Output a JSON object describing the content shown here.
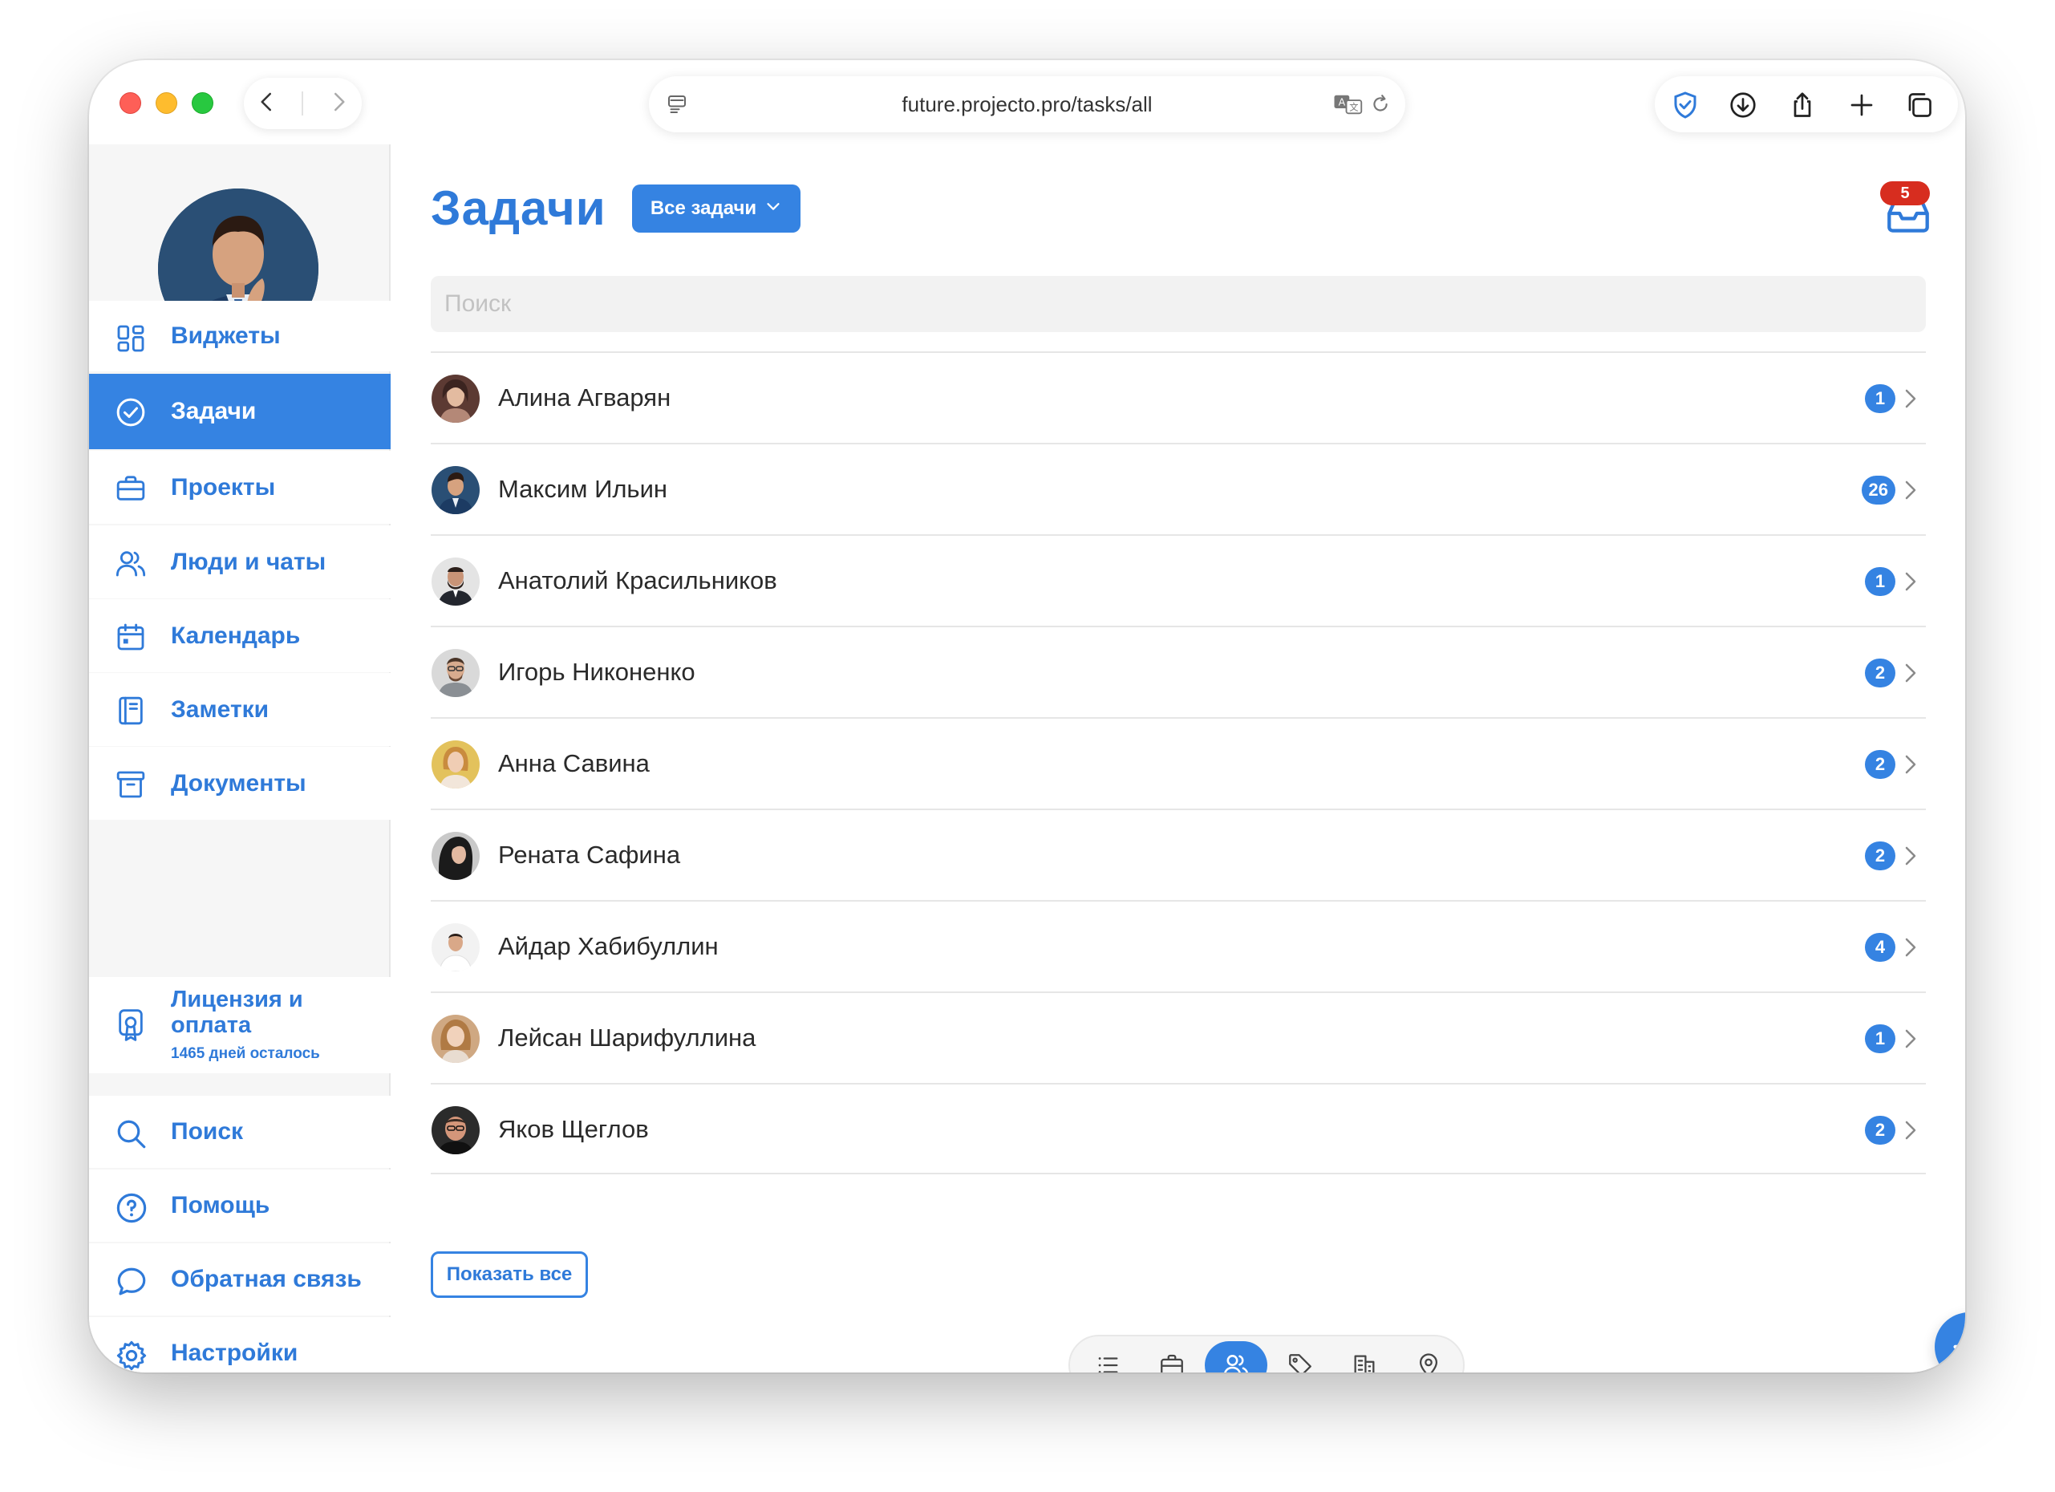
{
  "browser": {
    "url": "future.projecto.pro/tasks/all"
  },
  "sidebar": {
    "items": [
      {
        "label": "Виджеты",
        "icon": "widgets-icon"
      },
      {
        "label": "Задачи",
        "icon": "check-circle-icon",
        "active": true
      },
      {
        "label": "Проекты",
        "icon": "briefcase-icon"
      },
      {
        "label": "Люди и чаты",
        "icon": "people-icon"
      },
      {
        "label": "Календарь",
        "icon": "calendar-icon"
      },
      {
        "label": "Заметки",
        "icon": "notebook-icon"
      },
      {
        "label": "Документы",
        "icon": "archive-icon"
      }
    ],
    "license": {
      "title": "Лицензия и оплата",
      "subtitle": "1465 дней осталось"
    },
    "bottom_items": [
      {
        "label": "Поиск",
        "icon": "search-icon"
      },
      {
        "label": "Помощь",
        "icon": "help-icon"
      },
      {
        "label": "Обратная связь",
        "icon": "chat-bubble-icon"
      },
      {
        "label": "Настройки",
        "icon": "gear-icon"
      }
    ]
  },
  "main": {
    "title": "Задачи",
    "filter_label": "Все задачи",
    "inbox_badge": "5",
    "search_placeholder": "Поиск",
    "people": [
      {
        "name": "Алина Агварян",
        "count": "1"
      },
      {
        "name": "Максим Ильин",
        "count": "26"
      },
      {
        "name": "Анатолий Красильников",
        "count": "1"
      },
      {
        "name": "Игорь Никоненко",
        "count": "2"
      },
      {
        "name": "Анна Савина",
        "count": "2"
      },
      {
        "name": "Рената Сафина",
        "count": "2"
      },
      {
        "name": "Айдар Хабибуллин",
        "count": "4"
      },
      {
        "name": "Лейсан Шарифуллина",
        "count": "1"
      },
      {
        "name": "Яков Щеглов",
        "count": "2"
      }
    ],
    "show_all_label": "Показать все",
    "tabs": [
      {
        "icon": "list-icon"
      },
      {
        "icon": "briefcase-icon"
      },
      {
        "icon": "people-icon",
        "active": true
      },
      {
        "icon": "tag-icon"
      },
      {
        "icon": "building-icon"
      },
      {
        "icon": "location-pin-icon"
      }
    ]
  },
  "colors": {
    "accent": "#3583e2",
    "badge_red": "#d72d1f"
  }
}
